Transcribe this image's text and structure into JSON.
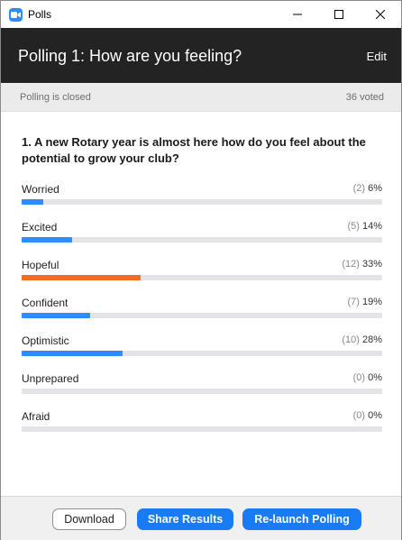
{
  "window": {
    "title": "Polls"
  },
  "header": {
    "title": "Polling 1: How are you feeling?",
    "edit_label": "Edit"
  },
  "status": {
    "state": "Polling is closed",
    "votes": "36 voted"
  },
  "question": {
    "text": "1. A new Rotary year is almost here how do you feel about the potential to grow your club?"
  },
  "answers": [
    {
      "label": "Worried",
      "count": "(2)",
      "percent": "6%",
      "value": 6,
      "highlight": false
    },
    {
      "label": "Excited",
      "count": "(5)",
      "percent": "14%",
      "value": 14,
      "highlight": false
    },
    {
      "label": "Hopeful",
      "count": "(12)",
      "percent": "33%",
      "value": 33,
      "highlight": true
    },
    {
      "label": "Confident",
      "count": "(7)",
      "percent": "19%",
      "value": 19,
      "highlight": false
    },
    {
      "label": "Optimistic",
      "count": "(10)",
      "percent": "28%",
      "value": 28,
      "highlight": false
    },
    {
      "label": "Unprepared",
      "count": "(0)",
      "percent": "0%",
      "value": 0,
      "highlight": false
    },
    {
      "label": "Afraid",
      "count": "(0)",
      "percent": "0%",
      "value": 0,
      "highlight": false
    }
  ],
  "footer": {
    "download_label": "Download",
    "share_label": "Share Results",
    "relaunch_label": "Re-launch Polling"
  },
  "colors": {
    "bar": "#2d8cff",
    "bar_top": "#f26d21",
    "header_bg": "#232323",
    "button_primary": "#1a7cf5"
  }
}
